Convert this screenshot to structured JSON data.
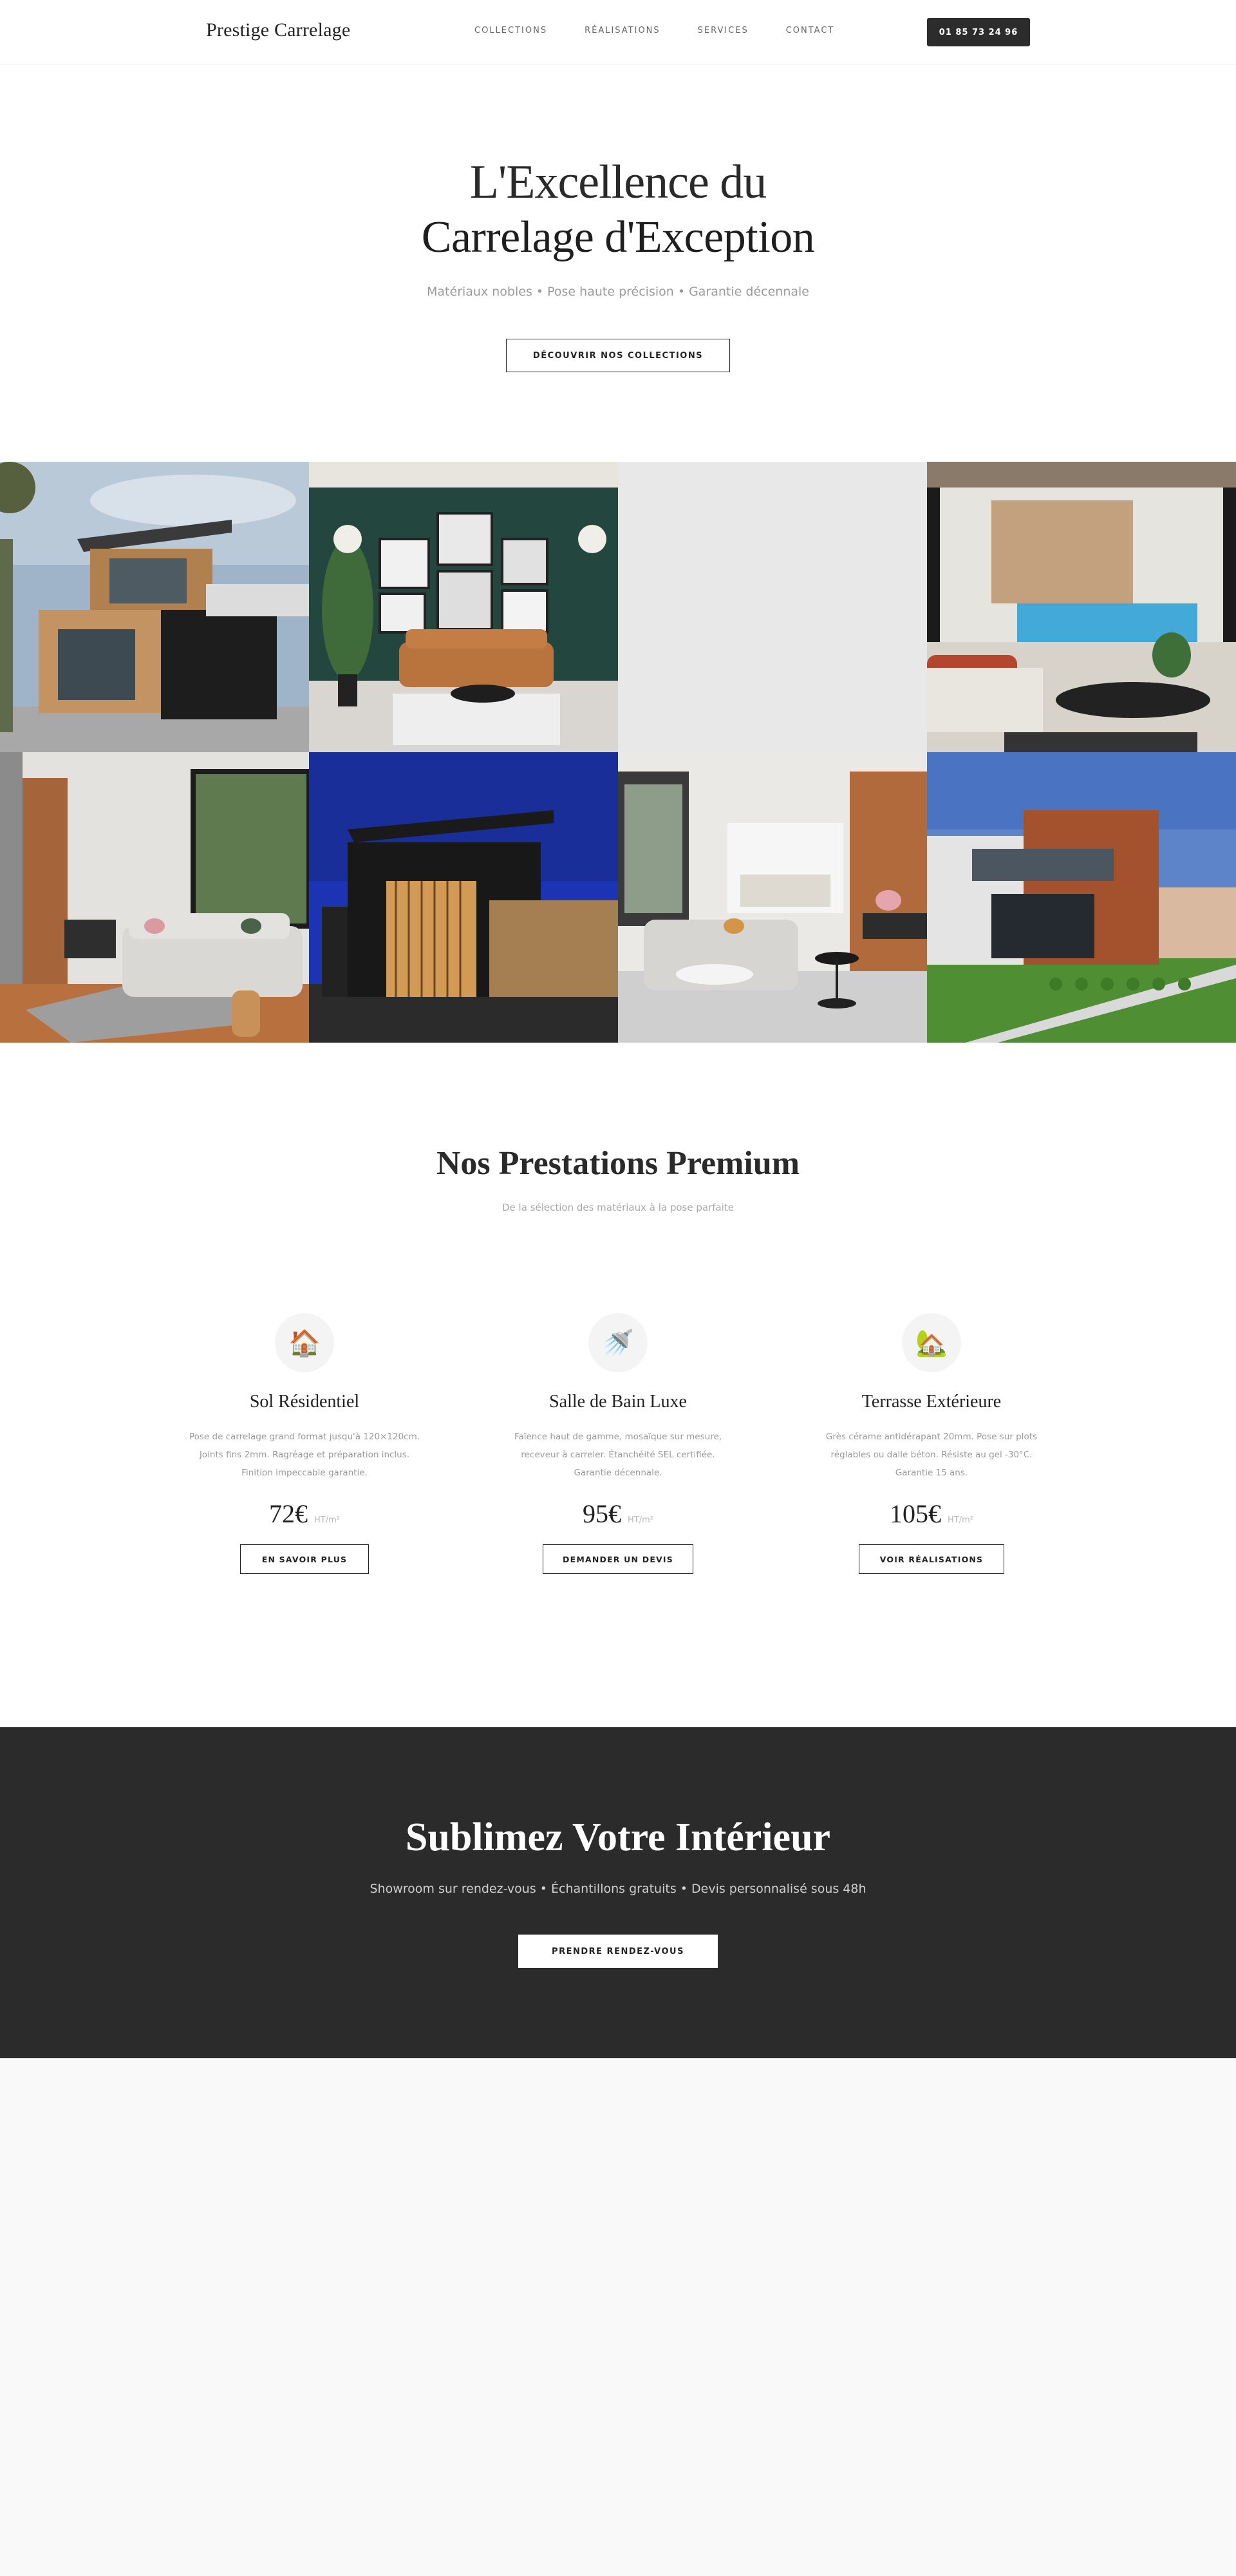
{
  "header": {
    "logo": "Prestige Carrelage",
    "nav": [
      "COLLECTIONS",
      "RÉALISATIONS",
      "SERVICES",
      "CONTACT"
    ],
    "phone": "01 85 73 24 96"
  },
  "hero": {
    "title_line1": "L'Excellence du",
    "title_line2": "Carrelage d'Exception",
    "subtitle": "Matériaux nobles • Pose haute précision • Garantie décennale",
    "button": "DÉCOUVRIR NOS COLLECTIONS"
  },
  "gallery": {
    "images": [
      "modern-house-exterior-wood",
      "living-room-green-wall",
      "image-placeholder-empty",
      "pool-terrace-living-room",
      "living-room-grey-sofa",
      "house-exterior-night",
      "open-kitchen-living-room",
      "house-exterior-wood-cladding"
    ]
  },
  "services": {
    "title": "Nos Prestations Premium",
    "subtitle": "De la sélection des matériaux à la pose parfaite",
    "cards": [
      {
        "icon": "house-icon",
        "icon_glyph": "🏠",
        "name": "Sol Résidentiel",
        "description": "Pose de carrelage grand format jusqu'à 120×120cm. Joints fins 2mm. Ragréage et préparation inclus. Finition impeccable garantie.",
        "price": "72€",
        "unit": "HT/m²",
        "button": "EN SAVOIR PLUS"
      },
      {
        "icon": "shower-icon",
        "icon_glyph": "🚿",
        "name": "Salle de Bain Luxe",
        "description": "Faïence haut de gamme, mosaïque sur mesure, receveur à carreler. Étanchéité SEL certifiée. Garantie décennale.",
        "price": "95€",
        "unit": "HT/m²",
        "button": "DEMANDER UN DEVIS"
      },
      {
        "icon": "house-garden-icon",
        "icon_glyph": "🏡",
        "name": "Terrasse Extérieure",
        "description": "Grès cérame antidérapant 20mm. Pose sur plots réglables ou dalle béton. Résiste au gel -30°C. Garantie 15 ans.",
        "price": "105€",
        "unit": "HT/m²",
        "button": "VOIR RÉALISATIONS"
      }
    ]
  },
  "cta": {
    "title": "Sublimez Votre Intérieur",
    "subtitle": "Showroom sur rendez-vous • Échantillons gratuits • Devis personnalisé sous 48h",
    "button": "PRENDRE RENDEZ-VOUS"
  }
}
